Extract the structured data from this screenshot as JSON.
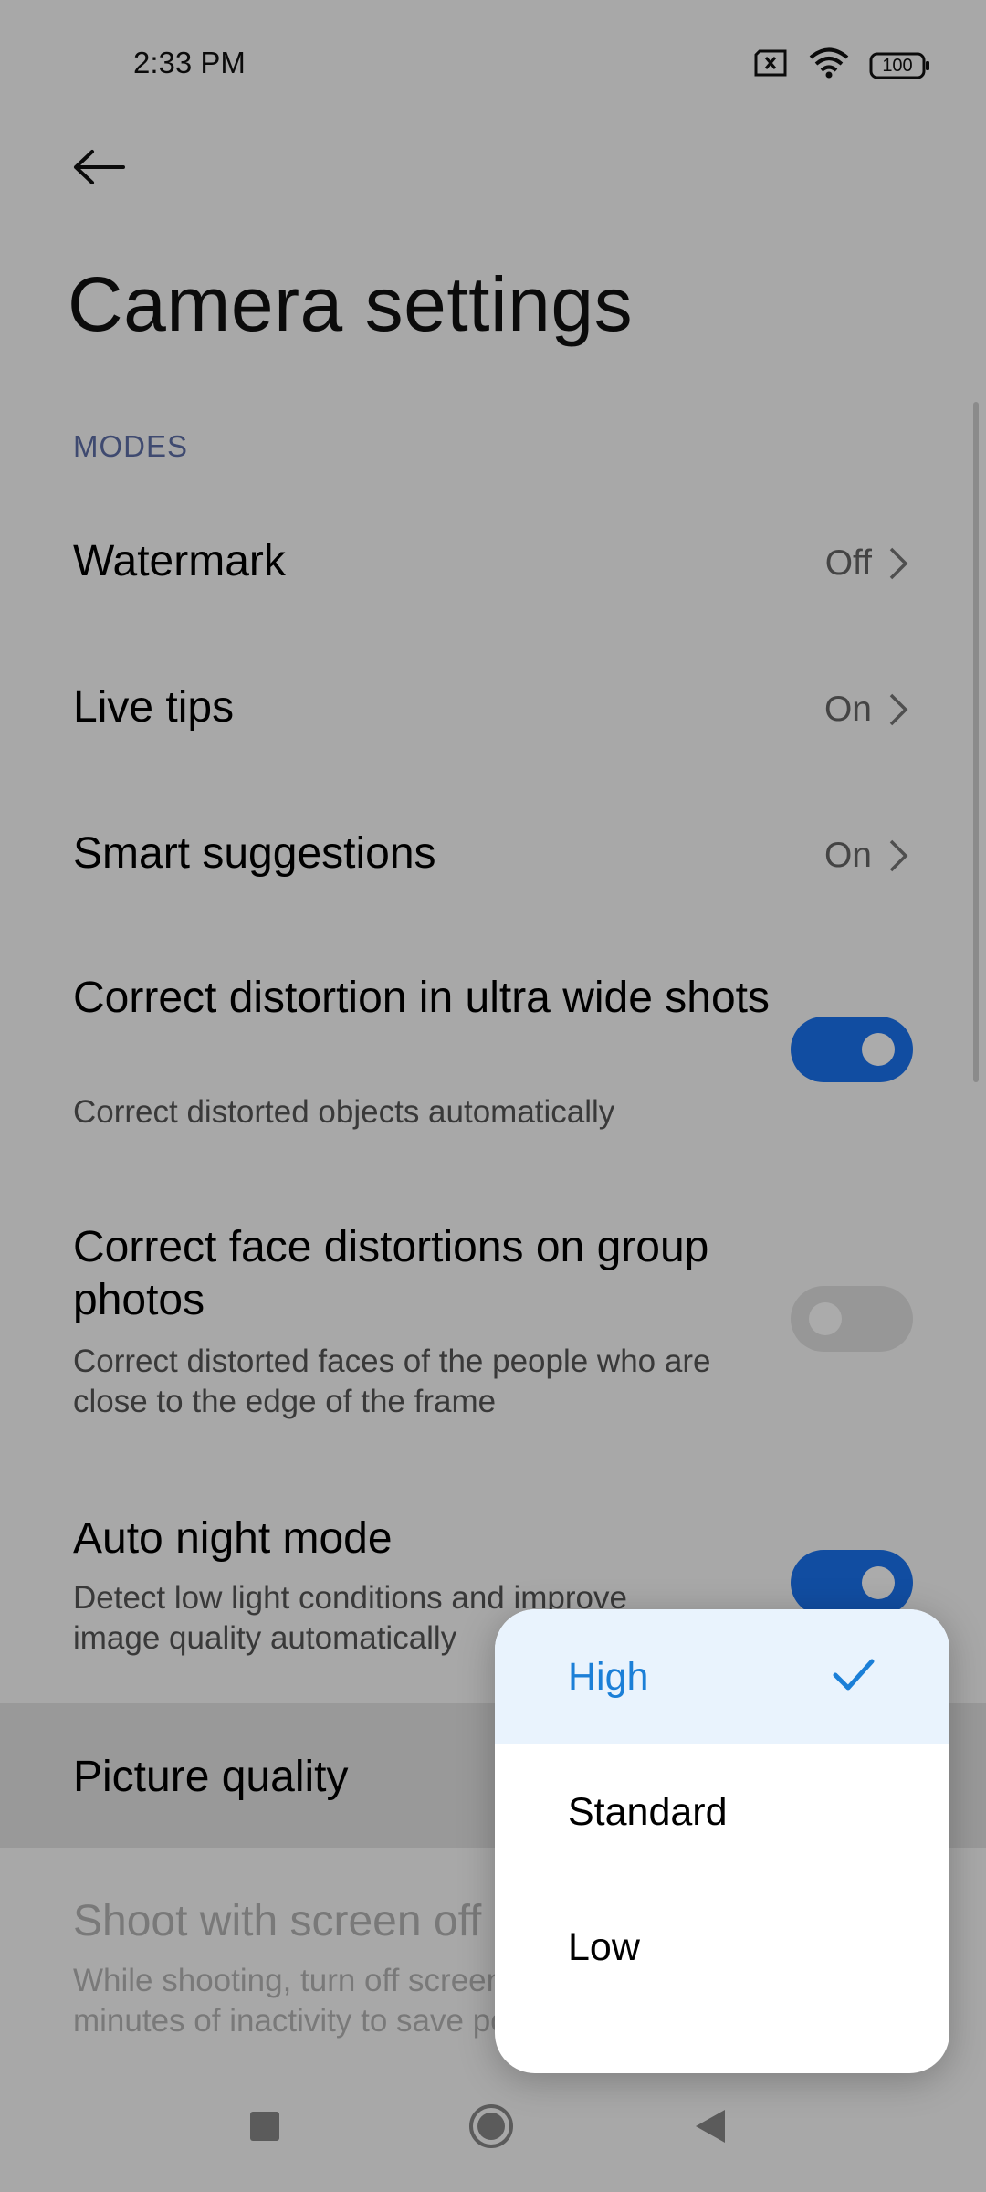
{
  "status_bar": {
    "time": "2:33 PM",
    "battery": "100",
    "icons": [
      "sim-error-icon",
      "wifi-icon",
      "battery-icon"
    ]
  },
  "page": {
    "title": "Camera settings"
  },
  "sections": {
    "modes_header": "MODES"
  },
  "settings": {
    "watermark": {
      "title": "Watermark",
      "value": "Off"
    },
    "live_tips": {
      "title": "Live tips",
      "value": "On"
    },
    "smart_suggestions": {
      "title": "Smart suggestions",
      "value": "On"
    },
    "correct_distortion": {
      "title": "Correct distortion in ultra wide shots",
      "subtitle": "Correct distorted objects automatically",
      "enabled": true
    },
    "face_distortion": {
      "title": "Correct face distortions on group photos",
      "subtitle": "Correct distorted faces of the people who are close to the edge of the frame",
      "enabled": false
    },
    "auto_night": {
      "title": "Auto night mode",
      "subtitle": "Detect low light conditions and improve image quality automatically",
      "enabled": true
    },
    "picture_quality": {
      "title": "Picture quality"
    },
    "screen_off": {
      "title": "Shoot with screen off",
      "subtitle": "While shooting, turn off screen after 2 minutes of inactivity to save power"
    }
  },
  "dropdown": {
    "options": [
      {
        "label": "High",
        "selected": true
      },
      {
        "label": "Standard",
        "selected": false
      },
      {
        "label": "Low",
        "selected": false
      }
    ]
  },
  "colors": {
    "accent": "#1a73f0",
    "selected_text": "#1b7fd7",
    "section_header": "#5f6fa8"
  }
}
